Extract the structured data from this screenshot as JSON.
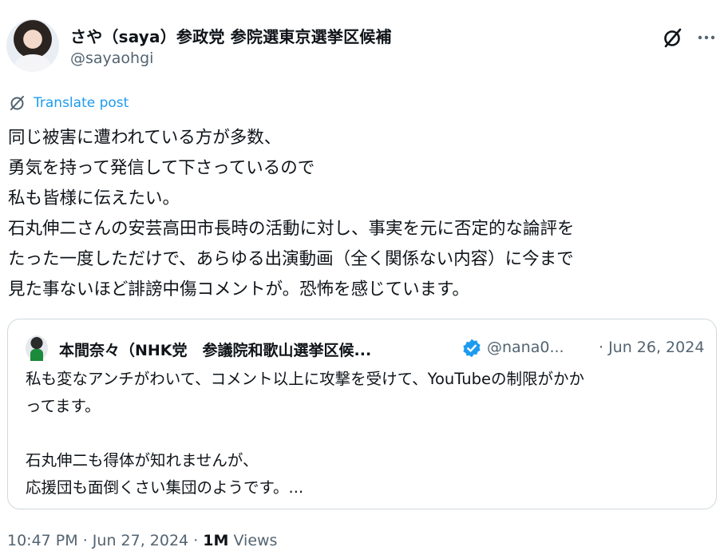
{
  "post": {
    "author_name": "さや（saya）参政党 参院選東京選挙区候補",
    "author_handle": "@sayaohgi",
    "translate_label": "Translate post",
    "body_lines": [
      "同じ被害に遭われている方が多数、",
      "勇気を持って発信して下さっているので",
      "私も皆様に伝えたい。",
      "石丸伸二さんの安芸高田市長時の活動に対し、事実を元に否定的な論評を",
      "たった一度しただけで、あらゆる出演動画（全く関係ない内容）に今まで",
      "見た事ないほど誹謗中傷コメントが。恐怖を感じています。"
    ],
    "time": "10:47 PM",
    "date": "Jun 27, 2024",
    "views_count": "1M",
    "views_label": "Views",
    "separator": "·"
  },
  "quote": {
    "author_name": "本間奈々（NHK党　参議院和歌山選挙区候...",
    "author_handle": "@nana0...",
    "date": "· Jun 26, 2024",
    "text_lines": [
      "私も変なアンチがわいて、コメント以上に攻撃を受けて、YouTubeの制限がかか",
      "ってます。",
      "",
      "石丸伸二も得体が知れませんが、",
      "応援団も面倒くさい集団のようです。..."
    ]
  },
  "icons": {
    "grok": "grok-icon",
    "more": "more-icon",
    "translate": "translate-icon",
    "verified": "verified-badge-icon"
  },
  "colors": {
    "text": "#0f1419",
    "secondary": "#536471",
    "link": "#1d9bf0",
    "border": "#cfd9de",
    "verified": "#1d9bf0"
  }
}
